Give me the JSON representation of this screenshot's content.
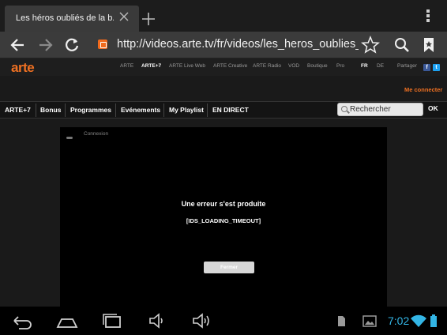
{
  "browser": {
    "tab_title": "Les héros oubliés de la b...",
    "url": "http://videos.arte.tv/fr/videos/les_heros_oublies_de_la"
  },
  "arte": {
    "logo": "arte",
    "nav": [
      "ARTE",
      "ARTE+7",
      "ARTE Live Web",
      "ARTE Creative",
      "ARTE Radio",
      "VOD",
      "Boutique",
      "Pro"
    ],
    "nav_active": "ARTE+7",
    "lang_fr": "FR",
    "lang_de": "DE",
    "partager": "Partager",
    "me_connecter": "Me connecter",
    "menu": [
      "ARTE+7",
      "Bonus",
      "Programmes",
      "Evénements",
      "My Playlist",
      "EN DIRECT"
    ],
    "search_placeholder": "Rechercher",
    "ok": "OK"
  },
  "player": {
    "connexion": "Connexion",
    "error_title": "Une erreur s'est produite",
    "error_code": "[IDS_LOADING_TIMEOUT]",
    "close_button": "Fermer"
  },
  "system": {
    "time": "7:02"
  },
  "colors": {
    "arte_orange": "#ee7022",
    "clock_blue": "#33b5e5"
  }
}
